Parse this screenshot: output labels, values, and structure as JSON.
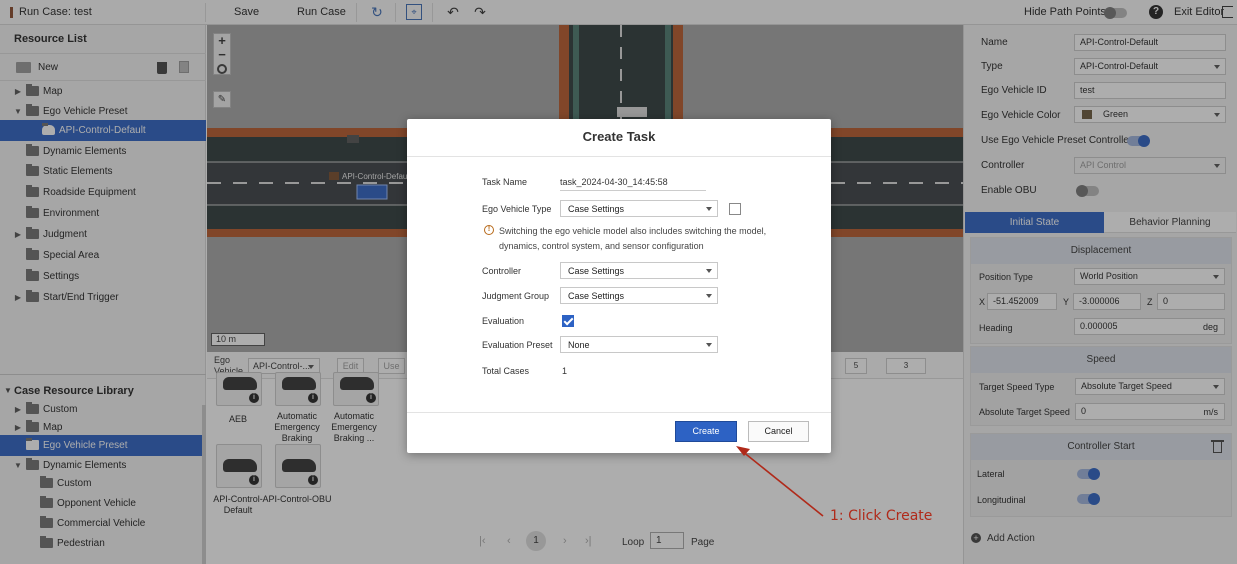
{
  "topbar": {
    "title": "Run Case: test",
    "save": "Save",
    "run_case": "Run Case",
    "hide_path_points": "Hide Path Points",
    "exit_editor": "Exit Editor"
  },
  "resource_list": {
    "title": "Resource List",
    "new": "New",
    "items": [
      {
        "label": "Map",
        "arrow": "▶"
      },
      {
        "label": "Ego Vehicle Preset",
        "arrow": "▼"
      },
      {
        "label": "API-Control-Default",
        "arrow": ""
      },
      {
        "label": "Dynamic Elements",
        "arrow": ""
      },
      {
        "label": "Static Elements",
        "arrow": ""
      },
      {
        "label": "Roadside Equipment",
        "arrow": ""
      },
      {
        "label": "Environment",
        "arrow": ""
      },
      {
        "label": "Judgment",
        "arrow": "▶"
      },
      {
        "label": "Special Area",
        "arrow": ""
      },
      {
        "label": "Settings",
        "arrow": ""
      },
      {
        "label": "Start/End Trigger",
        "arrow": "▶"
      }
    ]
  },
  "library": {
    "title": "Case Resource Library",
    "items": [
      {
        "label": "Custom",
        "arrow": "▶"
      },
      {
        "label": "Map",
        "arrow": "▶"
      },
      {
        "label": "Ego Vehicle Preset",
        "arrow": ""
      },
      {
        "label": "Dynamic Elements",
        "arrow": "▼"
      },
      {
        "label": "Custom",
        "arrow": ""
      },
      {
        "label": "Opponent Vehicle",
        "arrow": ""
      },
      {
        "label": "Commercial Vehicle",
        "arrow": ""
      },
      {
        "label": "Pedestrian",
        "arrow": ""
      }
    ]
  },
  "map": {
    "scale": "10 m",
    "vehicle_tag": "API-Control-Default",
    "zoom_in": "+",
    "zoom_out": "−"
  },
  "bottom": {
    "ego_label": "Ego Vehicle",
    "ego_select": "API-Control-...",
    "edit": "Edit",
    "use": "Use",
    "pager_right": [
      "5",
      "3"
    ],
    "cards": [
      {
        "label": "AEB"
      },
      {
        "label": "Automatic Emergency Braking"
      },
      {
        "label": "Automatic Emergency Braking ..."
      },
      {
        "label": "API-Control-Default"
      },
      {
        "label": "API-Control-OBU"
      }
    ],
    "page": "1",
    "loop": "Loop",
    "loop_value": "1",
    "page_word": "Page"
  },
  "props": {
    "name_label": "Name",
    "name_value": "API-Control-Default",
    "type_label": "Type",
    "type_value": "API-Control-Default",
    "ego_id_label": "Ego Vehicle ID",
    "ego_id_value": "test",
    "color_label": "Ego Vehicle Color",
    "color_value": "Green",
    "color_swatch": "#6b5a3c",
    "use_preset_label": "Use Ego Vehicle Preset Controller",
    "controller_label": "Controller",
    "controller_value": "API Control",
    "obu_label": "Enable OBU"
  },
  "tabs": {
    "initial": "Initial State",
    "behavior": "Behavior Planning"
  },
  "displacement": {
    "title": "Displacement",
    "pos_type_label": "Position Type",
    "pos_type_value": "World Position",
    "x": "X",
    "x_value": "-51.452009",
    "y": "Y",
    "y_value": "-3.000006",
    "z": "Z",
    "z_value": "0",
    "heading_label": "Heading",
    "heading_value": "0.000005",
    "heading_unit": "deg"
  },
  "speed": {
    "title": "Speed",
    "type_label": "Target Speed Type",
    "type_value": "Absolute Target Speed",
    "abs_label": "Absolute Target Speed",
    "abs_value": "0",
    "abs_unit": "m/s"
  },
  "controller_start": {
    "title": "Controller Start",
    "lateral": "Lateral",
    "longitudinal": "Longitudinal"
  },
  "add_action": "Add Action",
  "modal": {
    "title": "Create Task",
    "task_name_label": "Task Name",
    "task_name_value": "task_2024-04-30_14:45:58",
    "ego_type_label": "Ego Vehicle Type",
    "ego_type_value": "Case Settings",
    "notice": "Switching the ego vehicle model also includes switching the model, dynamics, control system, and sensor configuration",
    "controller_label": "Controller",
    "controller_value": "Case Settings",
    "judgment_label": "Judgment Group",
    "judgment_value": "Case Settings",
    "evaluation_label": "Evaluation",
    "preset_label": "Evaluation Preset",
    "preset_value": "None",
    "total_label": "Total Cases",
    "total_value": "1",
    "create": "Create",
    "cancel": "Cancel"
  },
  "annotation": "1: Click Create",
  "colors": {
    "accent": "#2d62c4",
    "annotation": "#b02a1a"
  }
}
